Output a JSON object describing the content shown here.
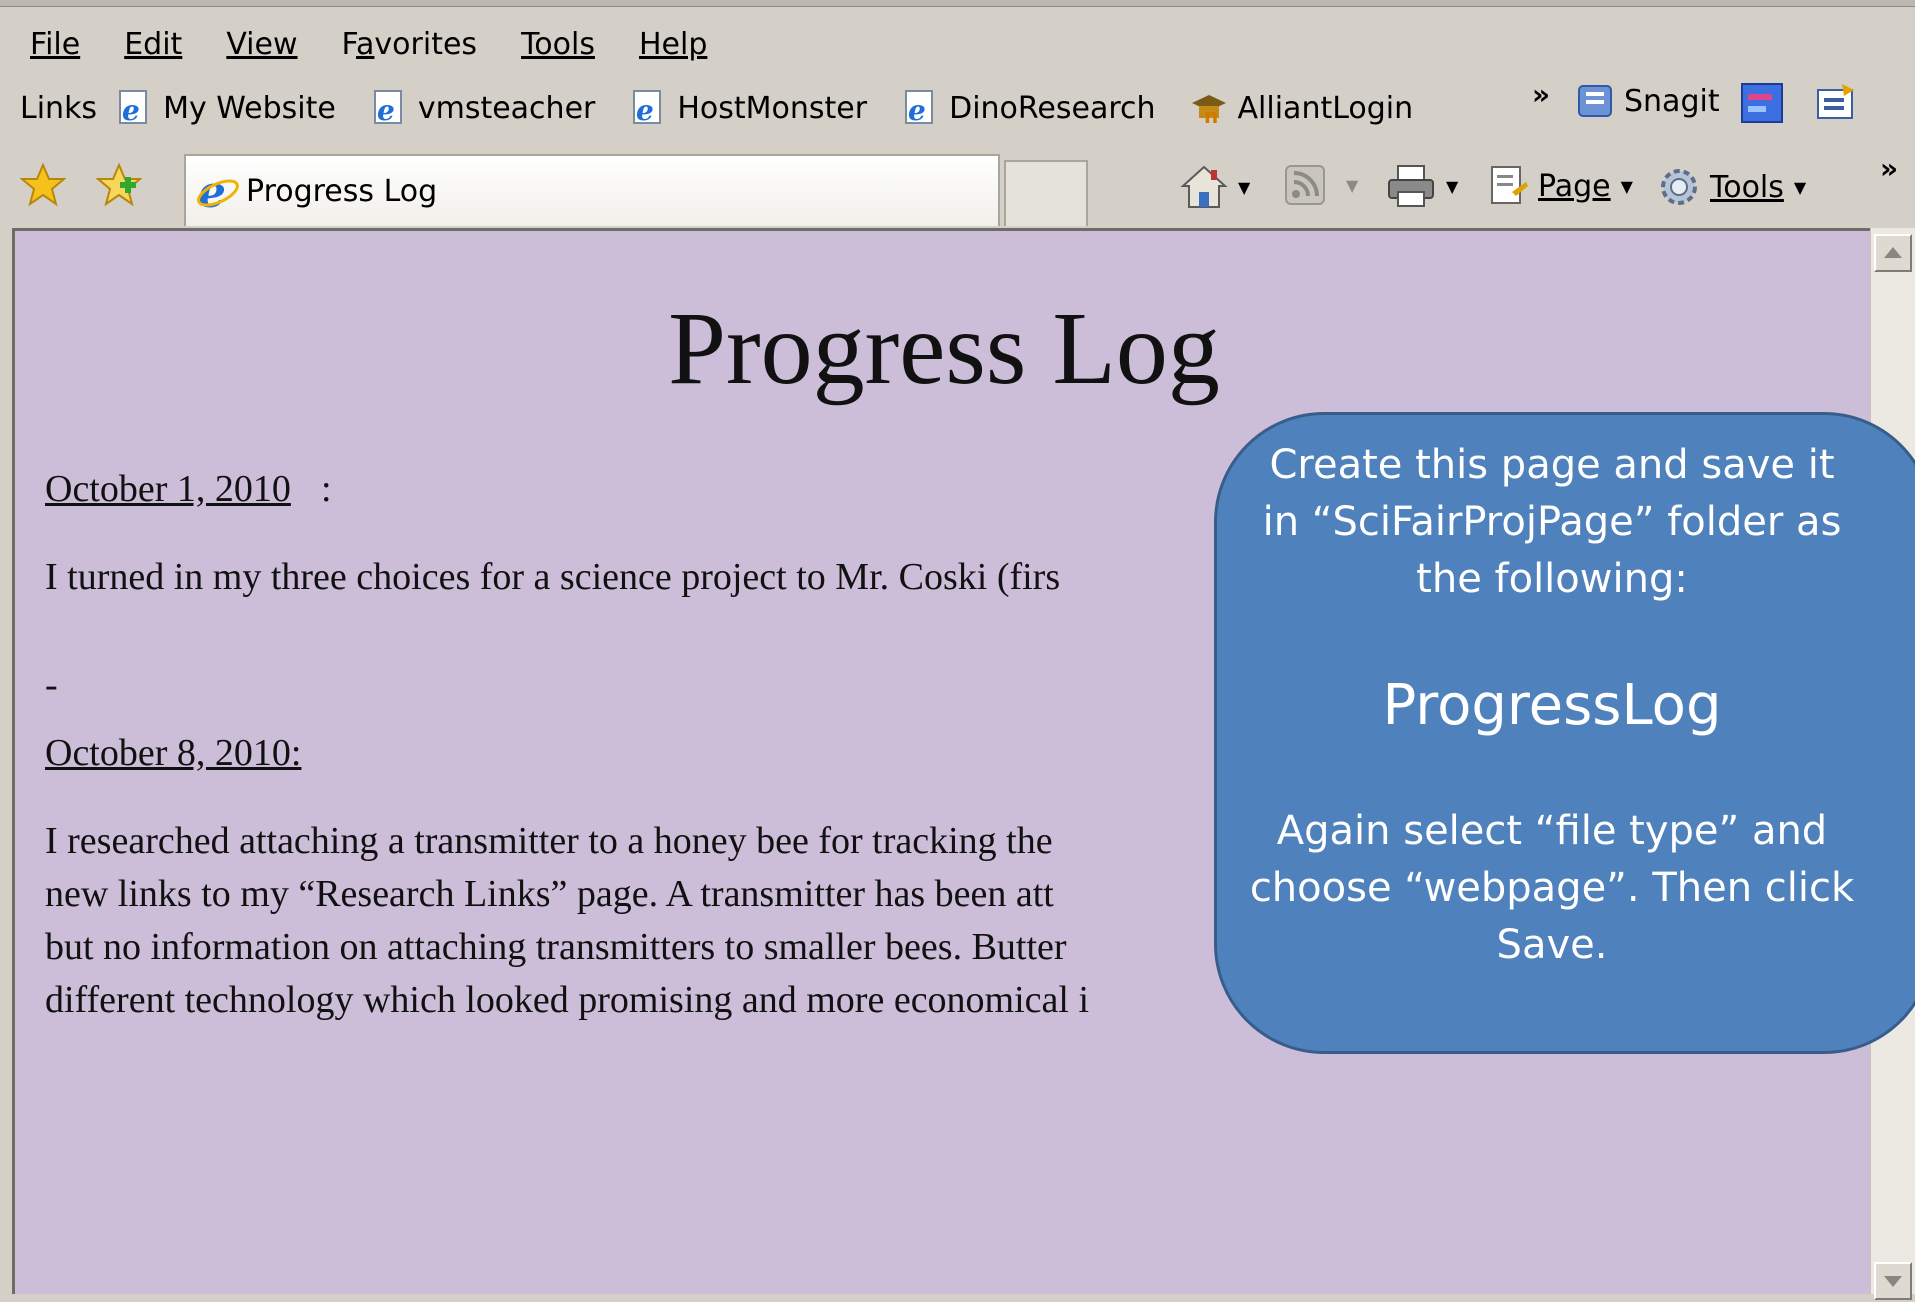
{
  "menu": [
    "File",
    "Edit",
    "View",
    "Favorites",
    "Tools",
    "Help"
  ],
  "menu_underline_index": [
    0,
    0,
    0,
    1,
    0,
    0
  ],
  "links_bar": {
    "label": "Links",
    "items": [
      "My Website",
      "vmsteacher",
      "HostMonster",
      "DinoResearch",
      "AlliantLogin"
    ],
    "overflow_icon": "double-chevron-icon",
    "snagit_label": "Snagit"
  },
  "tab": {
    "title": "Progress Log"
  },
  "commands": {
    "page_label": "Page",
    "tools_label": "Tools"
  },
  "page": {
    "title": "Progress Log",
    "entries": [
      {
        "date": "October 1, 2010",
        "suffix": ":",
        "text": "I turned in my three choices for a science project to Mr. Coski (firs"
      },
      {
        "date": "October 8, 2010:",
        "text": "I researched attaching a transmitter to a honey bee for tracking the\nnew links to my “Research Links” page. A transmitter has been att\nbut no information on attaching transmitters to smaller bees. Butter\ndifferent technology which looked promising and more economical i"
      }
    ],
    "separator": "-"
  },
  "callout": {
    "line1": "Create this page and save it in “SciFairProjPage” folder as the following:",
    "filename": "ProgressLog",
    "line2": "Again select “file type” and choose “webpage”. Then click Save."
  },
  "colors": {
    "page_bg": "#ccbed8",
    "callout_bg": "#4f81bd",
    "chrome_bg": "#d4d0c8"
  }
}
